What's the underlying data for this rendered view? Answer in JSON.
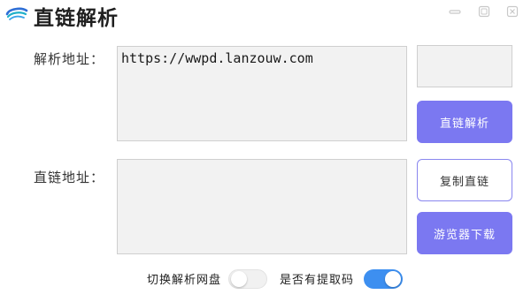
{
  "window": {
    "title": "直链解析",
    "logo_icon": "swirl-logo-icon",
    "controls": [
      "minimize-icon",
      "maximize-icon",
      "close-icon"
    ]
  },
  "form": {
    "parse_label": "解析地址：",
    "parse_value": "https://wwpd.lanzouw.com",
    "direct_label": "直链地址：",
    "direct_value": "",
    "code_value": ""
  },
  "buttons": {
    "parse": "直链解析",
    "copy": "复制直链",
    "download": "游览器下载"
  },
  "toggles": {
    "switch_label": "切换解析网盘",
    "switch_on": false,
    "code_label": "是否有提取码",
    "code_on": true
  },
  "colors": {
    "accent": "#7b78f1",
    "toggle_on": "#3d8ff0",
    "field_bg": "#f2f2f2"
  }
}
